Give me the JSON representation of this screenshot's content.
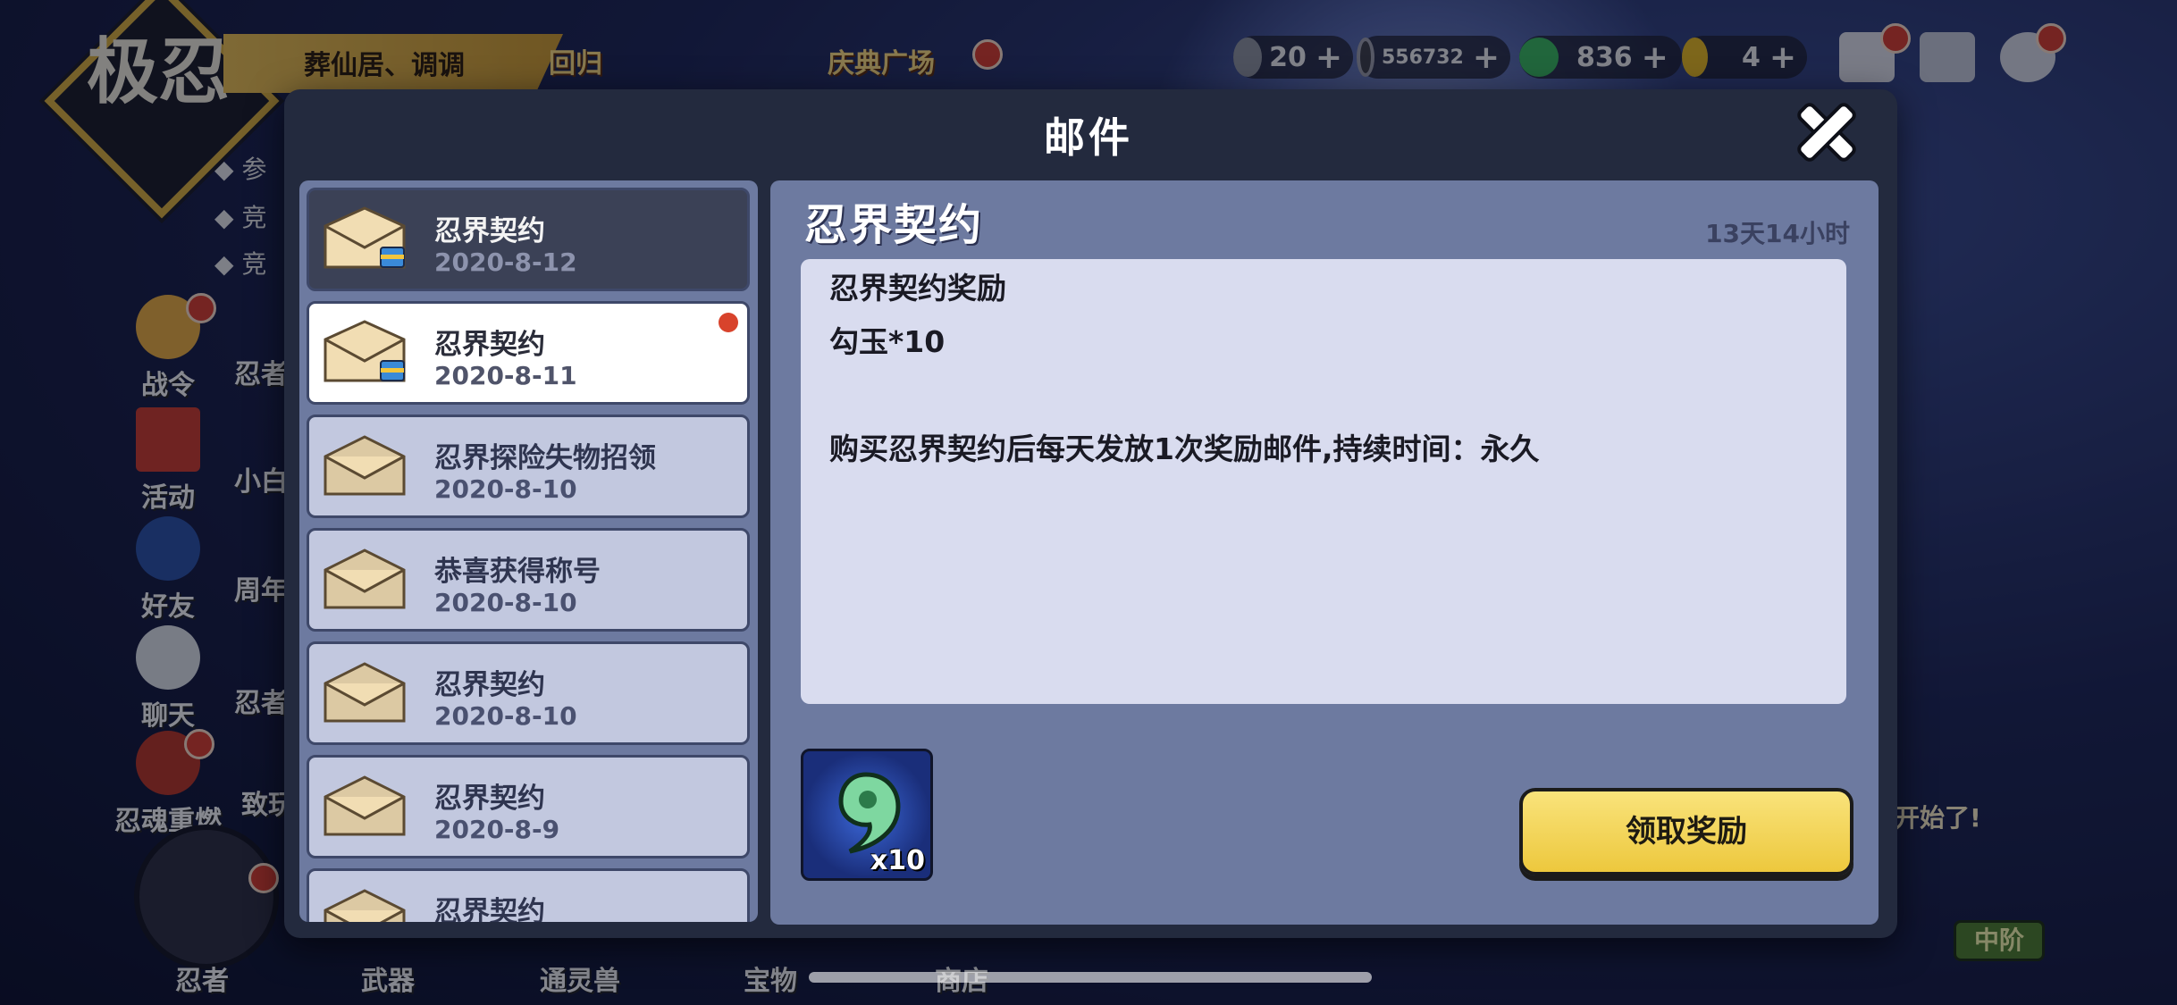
{
  "hud": {
    "logo_text": "极忍",
    "player_name": "葬仙居、调调",
    "event_tab_return": "回归",
    "event_tab_plaza": "庆典广场",
    "currency_energy": "20",
    "currency_coins": "556732",
    "currency_jade": "836",
    "currency_magatama": "4"
  },
  "side_menu": {
    "bullets": [
      "参",
      "竞",
      "竞"
    ],
    "items": [
      "战令",
      "活动",
      "好友",
      "聊天",
      "忍魂重燃"
    ],
    "partial": [
      "忍者",
      "小白",
      "周年",
      "忍者",
      "致玩"
    ]
  },
  "bottom_nav": [
    "忍者",
    "武器",
    "通灵兽",
    "宝物",
    "商店"
  ],
  "season": {
    "tag": "开始了!",
    "rank": "中阶"
  },
  "mail": {
    "title": "邮件",
    "list": [
      {
        "title": "忍界契约",
        "date": "2020-8-12"
      },
      {
        "title": "忍界契约",
        "date": "2020-8-11"
      },
      {
        "title": "忍界探险失物招领",
        "date": "2020-8-10"
      },
      {
        "title": "恭喜获得称号",
        "date": "2020-8-10"
      },
      {
        "title": "忍界契约",
        "date": "2020-8-10"
      },
      {
        "title": "忍界契约",
        "date": "2020-8-9"
      },
      {
        "title": "忍界契约",
        "date": ""
      }
    ],
    "detail": {
      "title": "忍界契约",
      "expiry": "13天14小时",
      "line1": "忍界契约奖励",
      "line2": "勾玉*10",
      "line3": "购买忍界契约后每天发放1次奖励邮件,持续时间：永久",
      "reward_qty": "x10",
      "claim_label": "领取奖励"
    }
  },
  "colors": {
    "accent_gold": "#edc83d",
    "panel": "#6d7aa0",
    "modal_bg": "#232a3e",
    "unread_dot": "#d8432c"
  }
}
